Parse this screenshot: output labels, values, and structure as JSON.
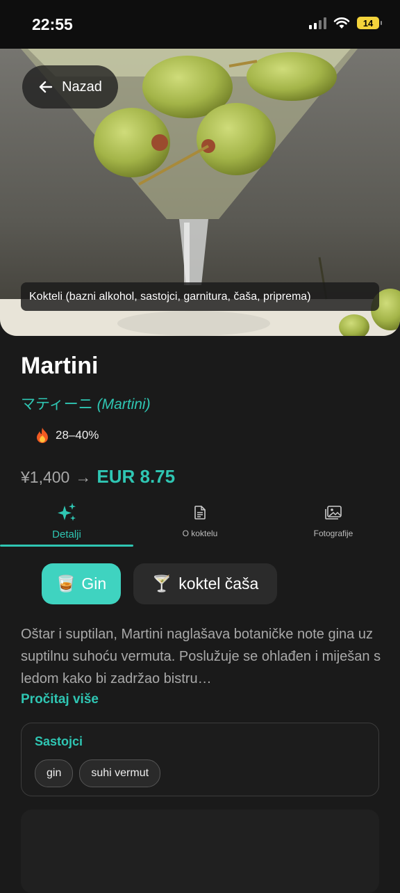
{
  "status": {
    "time": "22:55",
    "battery": "14"
  },
  "header": {
    "back_label": "Nazad"
  },
  "hero": {
    "caption": "Kokteli (bazni alkohol, sastojci, garnitura, čaša, priprema)"
  },
  "drink": {
    "name": "Martini",
    "native_name": "マティーニ",
    "native_romaji": "(Martini)",
    "abv": "28–40%",
    "price_jpy": "¥1,400",
    "price_arrow": "→",
    "price_eur": "EUR 8.75"
  },
  "tabs": [
    {
      "label": "Detalji",
      "icon": "sparkles-icon"
    },
    {
      "label": "O koktelu",
      "icon": "document-icon"
    },
    {
      "label": "Fotografije",
      "icon": "images-icon"
    }
  ],
  "chips": {
    "base": {
      "emoji": "🥃",
      "label": "Gin"
    },
    "glass": {
      "emoji": "🍸",
      "label": "koktel čaša"
    }
  },
  "description": "Oštar i suptilan, Martini naglašava botaničke note gina uz suptilnu suhoću vermuta. Poslužuje se ohlađen i miješan s ledom kako bi zadržao bistru…",
  "read_more": "Pročitaj više",
  "ingredients": {
    "title": "Sastojci",
    "items": [
      "gin",
      "suhi vermut"
    ]
  },
  "colors": {
    "accent": "#2fc6b3",
    "chip_active": "#3fd3c0",
    "background": "#1a1a1a"
  }
}
